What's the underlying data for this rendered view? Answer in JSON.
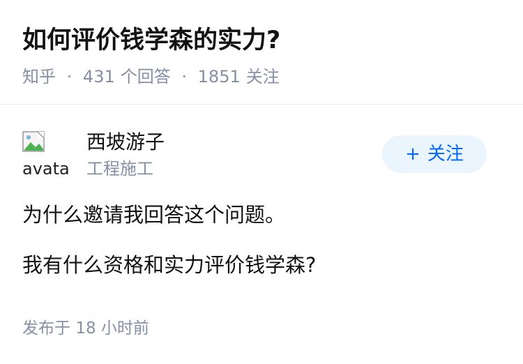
{
  "question": {
    "title": "如何评价钱学森的实力?",
    "meta": {
      "source": "知乎",
      "separator": "·",
      "answer_count": "431",
      "answer_label": "个回答",
      "follow_count": "1851",
      "follow_label": "关注"
    }
  },
  "author": {
    "avatar_alt": "avatar",
    "name": "西坡游子",
    "description": "工程施工",
    "follow_button": {
      "plus": "+",
      "label": "关注"
    }
  },
  "answer": {
    "paragraphs": [
      "为什么邀请我回答这个问题。",
      "我有什么资格和实力评价钱学森?"
    ],
    "published_label": "发布于",
    "published_time": "18 小时前"
  },
  "colors": {
    "title": "#121212",
    "meta_gray": "#8590a6",
    "follow_bg": "#ebf5fd",
    "follow_text": "#0066ff",
    "divider": "#ebebeb"
  },
  "icons": {
    "avatar": "broken-image-icon"
  }
}
